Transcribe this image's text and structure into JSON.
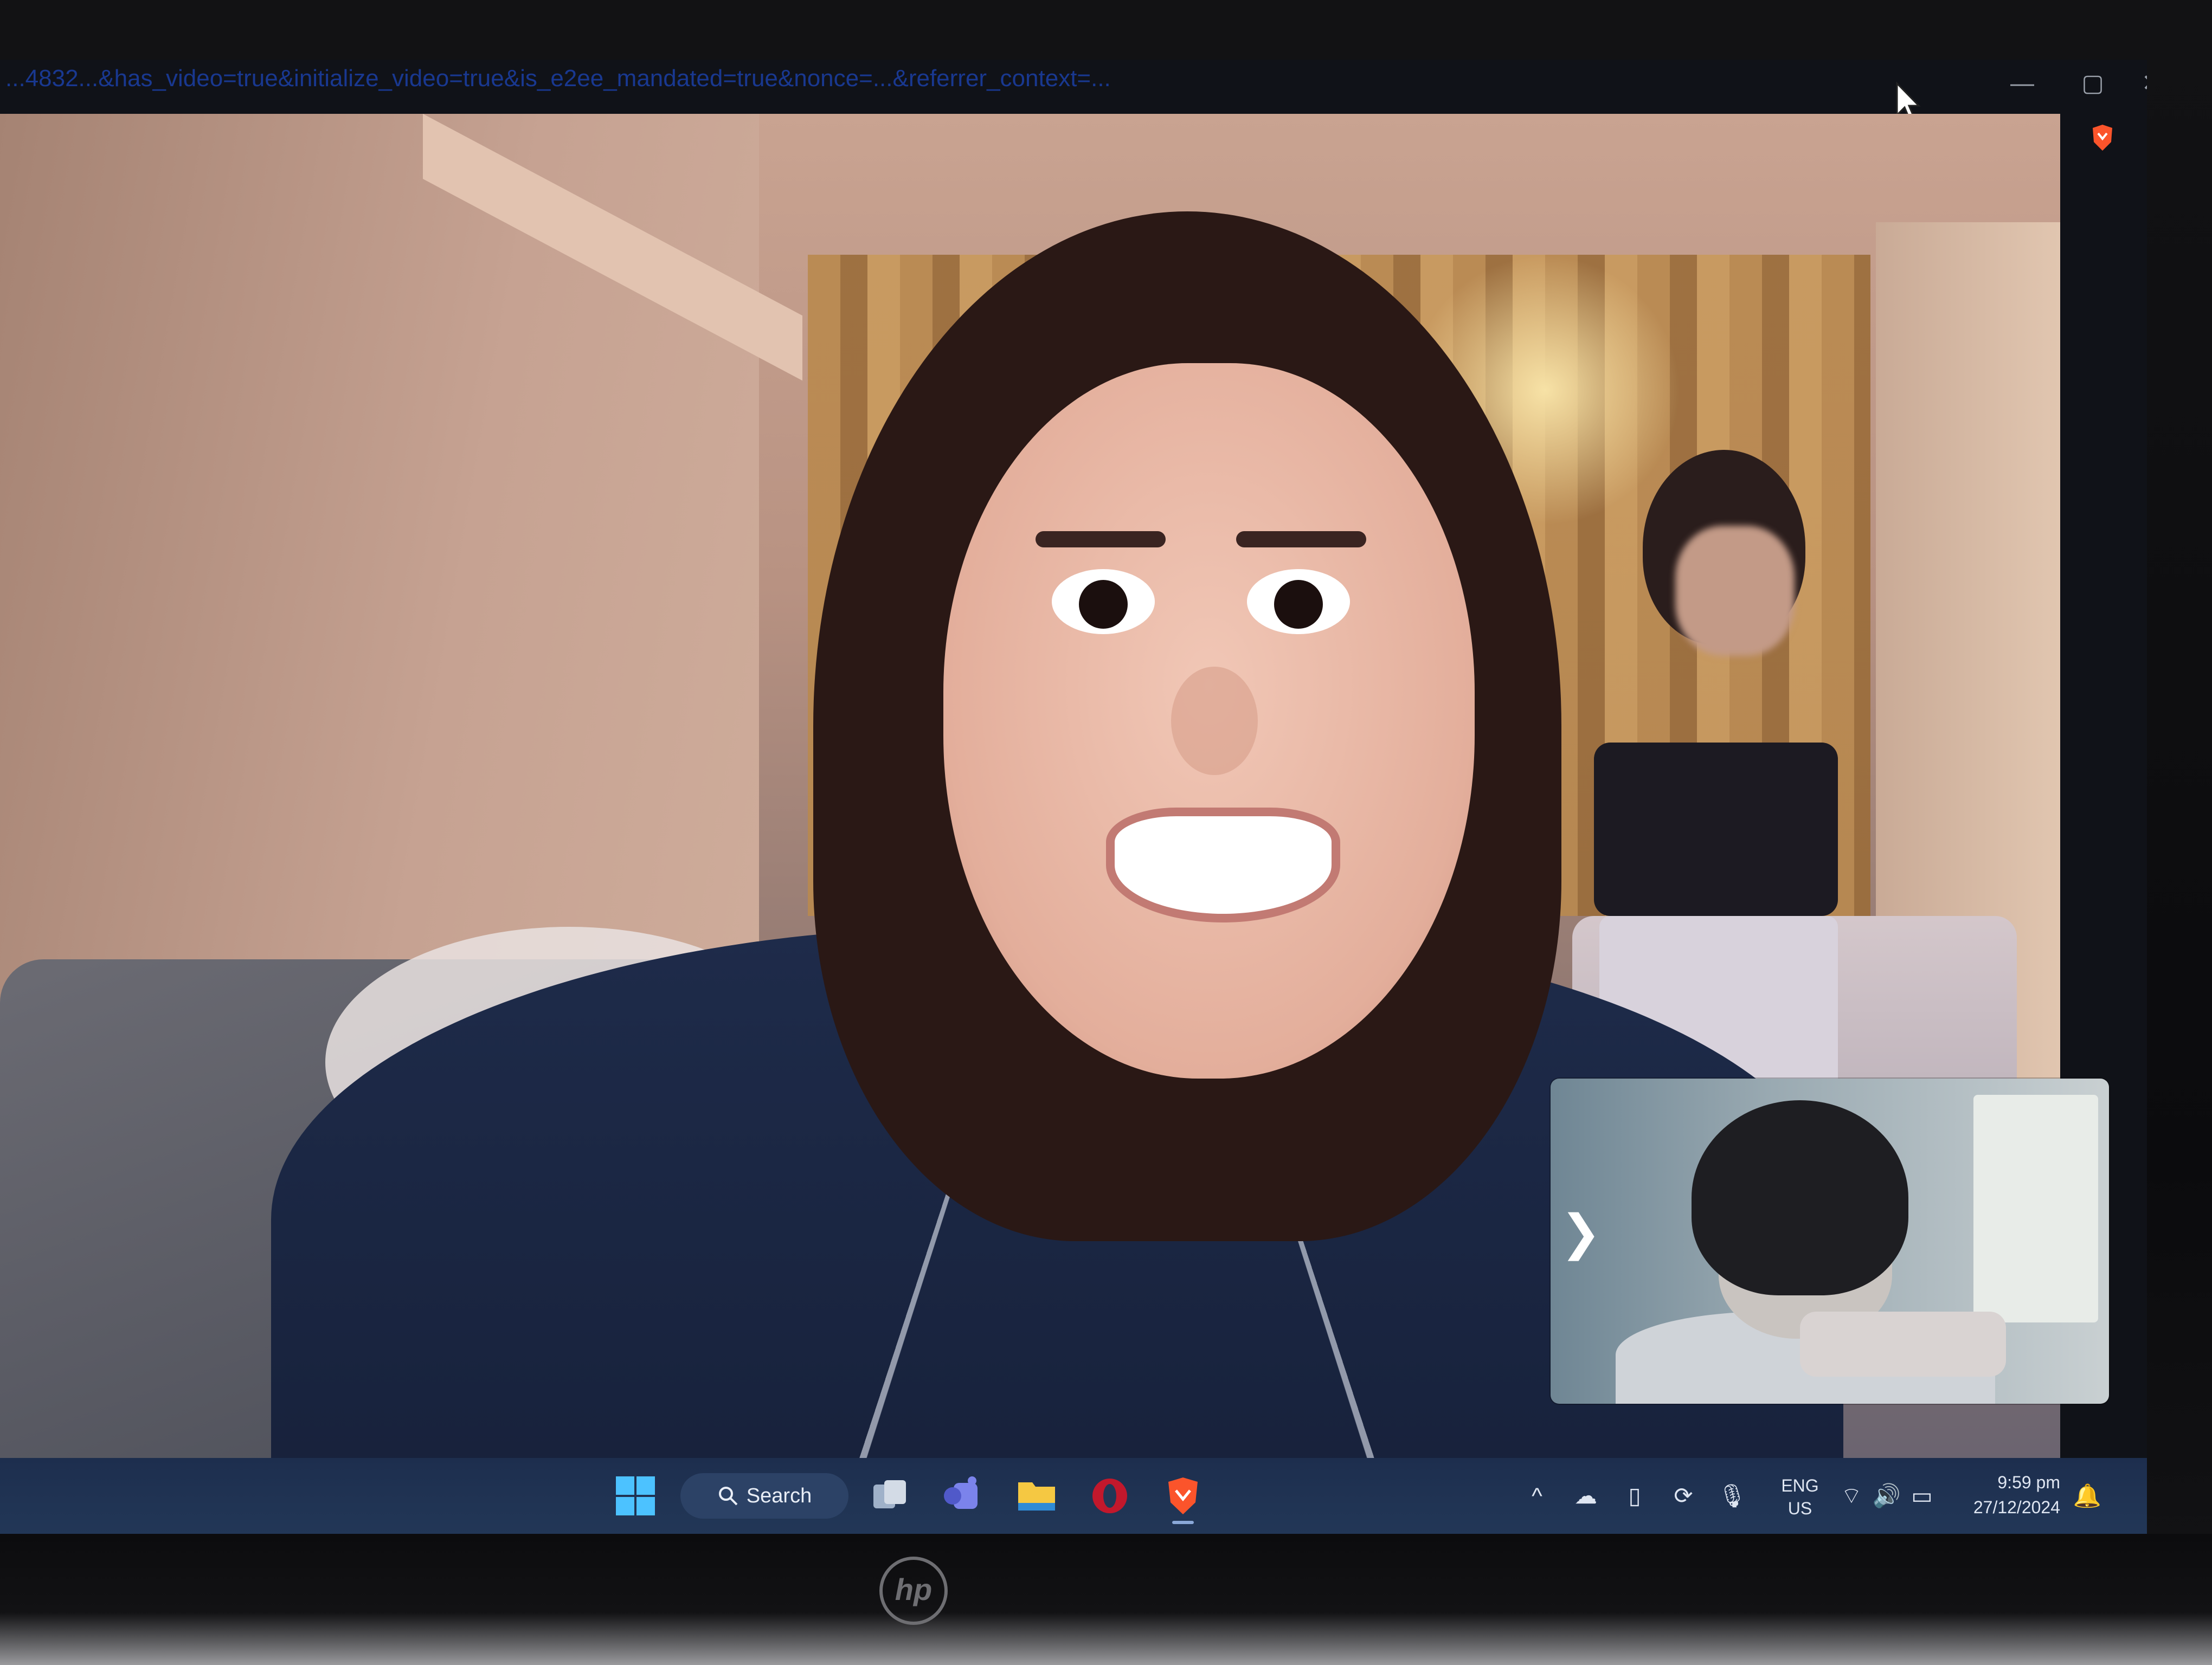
{
  "browser": {
    "url_text": "...4832...&has_video=true&initialize_video=true&is_e2ee_mandated=true&nonce=...&referrer_context=...",
    "window_controls": [
      "—",
      "▢",
      "✕"
    ],
    "extension_icon": "brave-icon"
  },
  "call": {
    "self_view_toggle": "❯"
  },
  "taskbar": {
    "search_label": "Search",
    "pinned_icons": [
      "windows-start-icon",
      "task-view-icon",
      "teams-icon",
      "file-explorer-icon",
      "opera-icon",
      "brave-icon"
    ],
    "tray": {
      "chevron": "^",
      "language_line1": "ENG",
      "language_line2": "US",
      "time": "9:59 pm",
      "date": "27/12/2024"
    }
  },
  "device": {
    "logo": "hp"
  },
  "colors": {
    "taskbar": "#1d2e4e",
    "url_text": "#1b3fa6",
    "brave_orange": "#fb542b"
  }
}
